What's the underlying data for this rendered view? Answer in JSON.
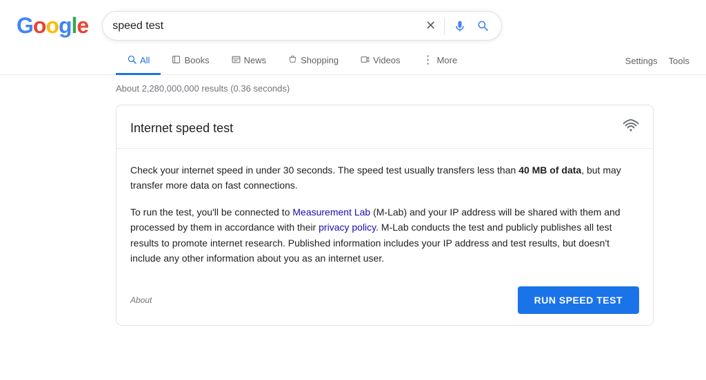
{
  "logo": {
    "letters": [
      {
        "char": "G",
        "class": "logo-g"
      },
      {
        "char": "o",
        "class": "logo-o1"
      },
      {
        "char": "o",
        "class": "logo-o2"
      },
      {
        "char": "g",
        "class": "logo-g2"
      },
      {
        "char": "l",
        "class": "logo-l"
      },
      {
        "char": "e",
        "class": "logo-e"
      }
    ],
    "text": "Google"
  },
  "search": {
    "query": "speed test",
    "placeholder": "Search"
  },
  "nav": {
    "tabs": [
      {
        "label": "All",
        "icon": "🔍",
        "active": true,
        "name": "tab-all"
      },
      {
        "label": "Books",
        "icon": "📄",
        "active": false,
        "name": "tab-books"
      },
      {
        "label": "News",
        "icon": "📰",
        "active": false,
        "name": "tab-news"
      },
      {
        "label": "Shopping",
        "icon": "🏷️",
        "active": false,
        "name": "tab-shopping"
      },
      {
        "label": "Videos",
        "icon": "▶",
        "active": false,
        "name": "tab-videos"
      },
      {
        "label": "More",
        "icon": "⋮",
        "active": false,
        "name": "tab-more"
      }
    ],
    "settings_label": "Settings",
    "tools_label": "Tools"
  },
  "results": {
    "count_text": "About 2,280,000,000 results (0.36 seconds)"
  },
  "speed_test_card": {
    "title": "Internet speed test",
    "wifi_icon": "📶",
    "paragraph1_prefix": "Check your internet speed in under 30 seconds. The speed test usually transfers less than ",
    "paragraph1_bold": "40 MB of data",
    "paragraph1_suffix": ", but may transfer more data on fast connections.",
    "paragraph2_prefix": "To run the test, you'll be connected to ",
    "measurement_lab_link": "Measurement Lab",
    "paragraph2_middle": " (M-Lab) and your IP address will be shared with them and processed by them in accordance with their ",
    "privacy_policy_link": "privacy policy",
    "paragraph2_suffix": ". M-Lab conducts the test and publicly publishes all test results to promote internet research. Published information includes your IP address and test results, but doesn't include any other information about you as an internet user.",
    "about_label": "About",
    "run_button_label": "RUN SPEED TEST"
  }
}
